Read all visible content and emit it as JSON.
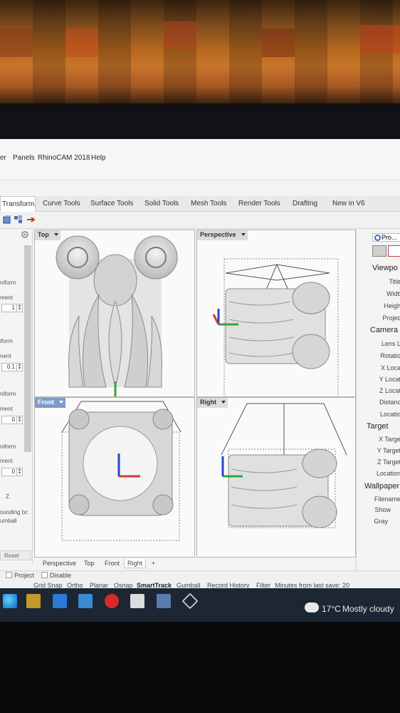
{
  "menubar": {
    "items": [
      "er",
      "Panels",
      "RhinoCAM 2018",
      "Help"
    ]
  },
  "ribbon": {
    "tabs": [
      "Transform",
      "Curve Tools",
      "Surface Tools",
      "Solid Tools",
      "Mesh Tools",
      "Render Tools",
      "Drafting",
      "New in V6"
    ]
  },
  "left_panel": {
    "labels": [
      "niform",
      "ment",
      "iform",
      "nent",
      "niform",
      "ment",
      "niform",
      "ment",
      "Z",
      "ounding bc",
      "umball"
    ],
    "values": [
      "1",
      "0.1",
      "0",
      "0"
    ],
    "reset_label": "Reset"
  },
  "viewports": {
    "top": "Top",
    "perspective": "Perspective",
    "front": "Front",
    "right": "Right"
  },
  "viewport_tabs": [
    "Perspective",
    "Top",
    "Front",
    "Right",
    "+"
  ],
  "right_panel": {
    "panel_title": "Pro...",
    "viewport_heading": "Viewpo",
    "viewport_items": [
      "Title",
      "Widtl",
      "Heigh",
      "Projec"
    ],
    "camera_heading": "Camera",
    "camera_items": [
      "Lens L",
      "Rotatio",
      "X Loca",
      "Y Locat",
      "Z Locat",
      "Distanc",
      "Locatio"
    ],
    "target_heading": "Target",
    "target_items": [
      "X Targe",
      "Y Target",
      "Z Target",
      "Location"
    ],
    "wallpaper_heading": "Wallpaper",
    "wallpaper_items": [
      "Filename",
      "Show",
      "Gray"
    ]
  },
  "status_bar": {
    "project_label": "Project",
    "disable_label": "Disable",
    "toggles": [
      "Grid Snap",
      "Ortho",
      "Planar",
      "Osnap",
      "SmartTrack",
      "Gumball",
      "Record History",
      "Filter"
    ],
    "save_info": "Minutes from last save: 20"
  },
  "taskbar": {
    "weather_temp": "17°C",
    "weather_desc": "Mostly cloudy"
  },
  "colors": {
    "active_viewport": "#7f9cc9",
    "axis_x": "#d23a2a",
    "axis_y": "#2da838",
    "axis_z": "#2a44c8",
    "taskbar": "#1d2633"
  }
}
